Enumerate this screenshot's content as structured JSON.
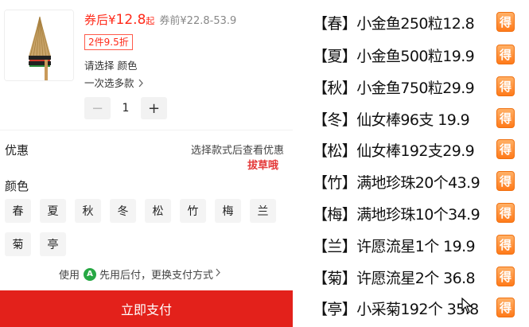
{
  "product": {
    "price_prefix": "券后¥",
    "price_value": "12.8",
    "price_suffix": "起",
    "price_before": "券前¥22.8-53.9",
    "promo": "2件9.5折",
    "choose_hint": "请选择 颜色",
    "multi_select": "一次选多款",
    "quantity": "1",
    "minus": "−",
    "plus": "+"
  },
  "offers": {
    "label": "优惠",
    "hint": "选择款式后查看优惠",
    "stamp": "拔草哦"
  },
  "colors": {
    "label": "颜色",
    "options": [
      "春",
      "夏",
      "秋",
      "冬",
      "松",
      "竹",
      "梅",
      "兰",
      "菊",
      "亭"
    ]
  },
  "payment": {
    "prefix": "使用",
    "logo": "A",
    "method": "先用后付，更换支付方式",
    "button": "立即支付"
  },
  "right_list": {
    "items": [
      "【春】小金鱼250粒12.8",
      "【夏】小金鱼500粒19.9",
      "【秋】小金鱼750粒29.9",
      "【冬】仙女棒96支  19.9",
      "【松】仙女棒192支29.9",
      "【竹】满地珍珠20个43.9",
      "【梅】满地珍珠10个34.9",
      "【兰】许愿流星1个  19.9",
      "【菊】许愿流星2个   36.8",
      "【亭】小采菊192个  35.8"
    ],
    "badge": "得"
  },
  "colors_hex": {
    "accent_red": "#e3211b",
    "price_red": "#ff2a1a",
    "badge_orange": "#ff7a1a"
  }
}
